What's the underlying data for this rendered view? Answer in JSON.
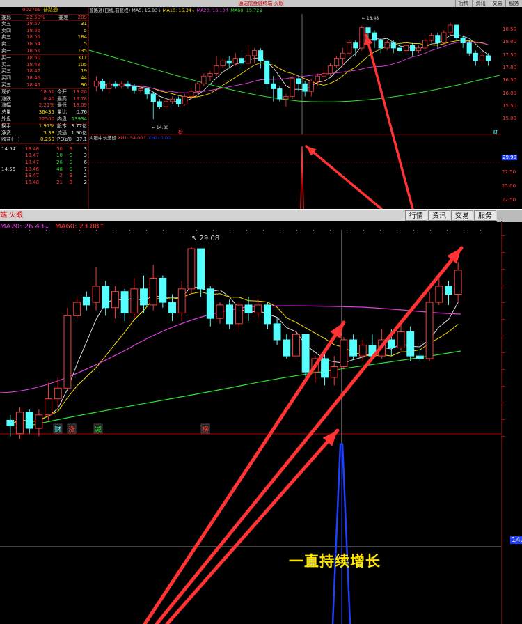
{
  "window": {
    "title": "通达信金融终端 火眼",
    "buttons": [
      "行情",
      "资讯",
      "交易",
      "服务"
    ]
  },
  "quote": {
    "code": "002769",
    "name": "普路通",
    "weibi_label": "委比",
    "weibi": "22.50%",
    "weicha_label": "委差",
    "weicha": "209",
    "asks": [
      {
        "label": "卖五",
        "price": "18.57",
        "vol": "31"
      },
      {
        "label": "卖四",
        "price": "18.56",
        "vol": "5"
      },
      {
        "label": "卖三",
        "price": "18.55",
        "vol": "184"
      },
      {
        "label": "卖二",
        "price": "18.54",
        "vol": "5"
      },
      {
        "label": "卖一",
        "price": "18.51",
        "vol": "135"
      }
    ],
    "bids": [
      {
        "label": "买一",
        "price": "18.50",
        "vol": "311"
      },
      {
        "label": "买二",
        "price": "18.48",
        "vol": "105"
      },
      {
        "label": "买三",
        "price": "18.47",
        "vol": "19"
      },
      {
        "label": "买四",
        "price": "18.46",
        "vol": "44"
      },
      {
        "label": "买五",
        "price": "18.45",
        "vol": "90"
      }
    ],
    "stats": [
      {
        "l1": "现价",
        "v1": "18.51",
        "l2": "今开",
        "v2": "18.20"
      },
      {
        "l1": "涨跌",
        "v1": "0.40",
        "l2": "最高",
        "v2": "18.78"
      },
      {
        "l1": "涨幅",
        "v1": "2.21%",
        "l2": "最低",
        "v2": "18.09"
      },
      {
        "l1": "总量",
        "v1": "36435",
        "l2": "量比",
        "v2": "0.76"
      },
      {
        "l1": "外盘",
        "v1": "22500",
        "l2": "内盘",
        "v2": "13934"
      }
    ],
    "stats2": [
      {
        "l1": "换手",
        "v1": "1.91%",
        "l2": "股本",
        "v2": "3.77亿"
      },
      {
        "l1": "净资",
        "v1": "3.38",
        "l2": "流通",
        "v2": "1.90亿"
      },
      {
        "l1": "收益(一)",
        "v1": "0.250",
        "l2": "PE(动)",
        "v2": "37.1"
      }
    ],
    "ticks": [
      {
        "time": "14:54",
        "price": "18.48",
        "vol": "30",
        "bs": "B",
        "n": "3"
      },
      {
        "time": "",
        "price": "18.47",
        "vol": "10",
        "bs": "S",
        "n": "3"
      },
      {
        "time": "",
        "price": "18.47",
        "vol": "26",
        "bs": "S",
        "n": "6"
      },
      {
        "time": "14:55",
        "price": "18.46",
        "vol": "46",
        "bs": "S",
        "n": "7"
      },
      {
        "time": "",
        "price": "18.47",
        "vol": "2",
        "bs": "B",
        "n": "2"
      },
      {
        "time": "",
        "price": "18.48",
        "vol": "21",
        "bs": "B",
        "n": "2"
      }
    ]
  },
  "top_chart": {
    "title": "普路通(日线,前复权)",
    "ma_legend": [
      {
        "label": "MA5: 15.83↓",
        "color": "#dddddd"
      },
      {
        "label": "MA10: 16.34↓",
        "color": "#ffde00"
      },
      {
        "label": "MA20: 16.10↑",
        "color": "#e040e0"
      },
      {
        "label": "MA60: 15.72↓",
        "color": "#2ee62e"
      }
    ],
    "indicator_title": "火眼中长波段",
    "indicator_values": [
      "XH1: 34.00↑",
      "XH2: 0.00"
    ],
    "price_ticks": [
      "18.50",
      "18.00",
      "17.50",
      "17.00",
      "16.50",
      "16.00",
      "15.50",
      "15.00"
    ],
    "indicator_ticks": [
      "29.99",
      "27.50",
      "25.00",
      "22.50"
    ],
    "max_label": "18.48",
    "min_label": "14.80",
    "tag_left": "榜",
    "tag_right": "财"
  },
  "main_chart": {
    "title_left": "端 火眼",
    "ma_legend": [
      {
        "label": "MA20: 26.43↓",
        "color": "#e040e0"
      },
      {
        "label": "MA60: 23.88↑",
        "color": "#2ee62e"
      }
    ],
    "max_label": "29.08",
    "event_tags": [
      "财",
      "涨",
      "减",
      "榜"
    ],
    "axis_value": "14.",
    "caption": "一直持续增长"
  },
  "colors": {
    "up": "#ff3c3c",
    "down": "#55ffff",
    "ma5": "#dddddd",
    "ma10": "#ffde00",
    "ma20": "#e040e0",
    "ma60": "#2ee62e",
    "arrow": "#ff3333",
    "spike": "#2040ff"
  }
}
